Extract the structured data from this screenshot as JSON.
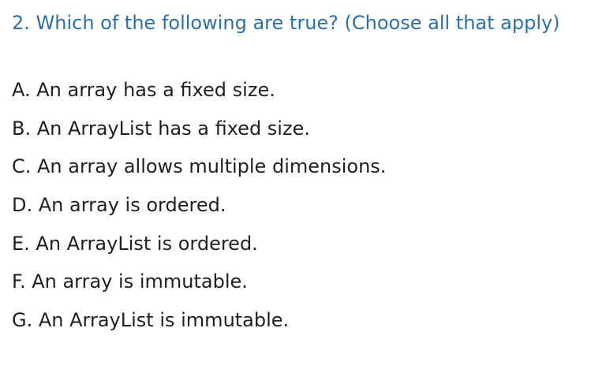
{
  "question": {
    "text": "2. Which of the following are true? (Choose all that apply)"
  },
  "options": [
    "A. An array has a fixed size.",
    "B. An ArrayList has a fixed size.",
    "C. An array allows multiple dimensions.",
    "D. An array is ordered.",
    "E. An ArrayList is ordered.",
    "F. An array is immutable.",
    "G. An ArrayList is immutable."
  ],
  "colors": {
    "question": "#2e6fa5",
    "option_text": "#1f1f1f",
    "background": "#ffffff"
  }
}
